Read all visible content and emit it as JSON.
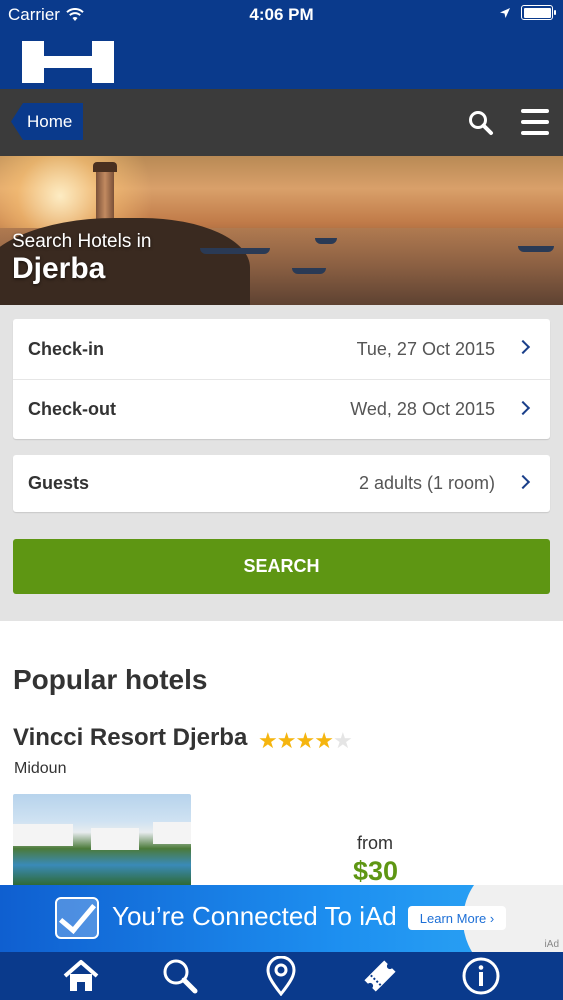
{
  "status_bar": {
    "carrier": "Carrier",
    "time": "4:06 PM",
    "battery_level": 1.0
  },
  "brand": {
    "logo_icon": "hotels-h-logo-icon",
    "color": "#0a3a8c"
  },
  "nav": {
    "home_label": "Home",
    "search_icon": "search-icon",
    "menu_icon": "hamburger-menu-icon"
  },
  "hero": {
    "kicker": "Search Hotels in",
    "city": "Djerba"
  },
  "form": {
    "checkin": {
      "label": "Check-in",
      "value": "Tue, 27 Oct 2015"
    },
    "checkout": {
      "label": "Check-out",
      "value": "Wed, 28 Oct 2015"
    },
    "guests": {
      "label": "Guests",
      "value": "2 adults (1 room)"
    },
    "search_label": "SEARCH"
  },
  "popular": {
    "heading": "Popular hotels",
    "hotels": [
      {
        "name": "Vincci Resort Djerba",
        "stars": 4,
        "max_stars": 5,
        "location": "Midoun",
        "from_label": "from",
        "price": "$30"
      }
    ]
  },
  "ad": {
    "message": "You’re Connected To iAd",
    "button": "Learn More ›",
    "tag": "iAd"
  },
  "tabbar": {
    "items": [
      "home-icon",
      "search-icon",
      "location-pin-icon",
      "ticket-icon",
      "info-icon"
    ]
  },
  "colors": {
    "accent_blue": "#0a3a8c",
    "accent_green": "#5e9613",
    "star": "#f5b50f"
  }
}
